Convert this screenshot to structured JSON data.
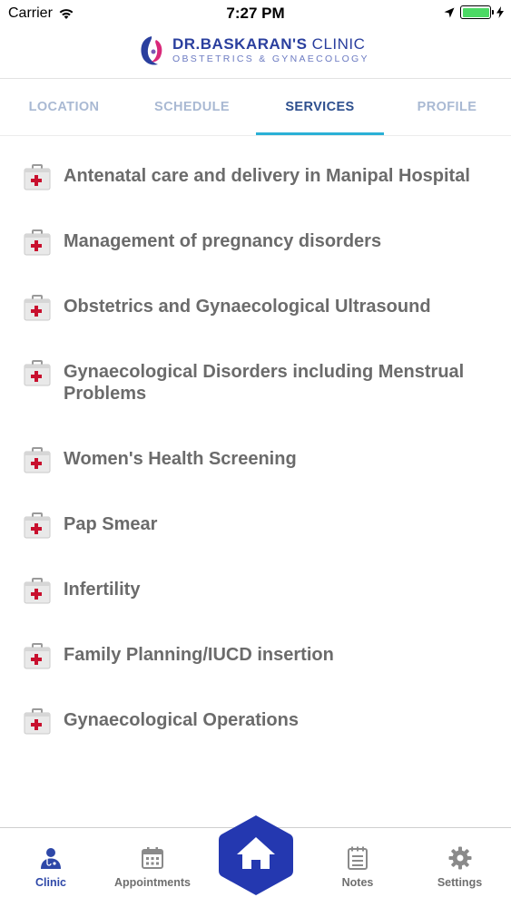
{
  "status_bar": {
    "carrier": "Carrier",
    "time": "7:27 PM"
  },
  "header": {
    "brand_strong": "DR.BASKARAN'S",
    "brand_light": " CLINIC",
    "subtitle": "OBSTETRICS & GYNAECOLOGY"
  },
  "tabs": [
    {
      "label": "LOCATION",
      "active": false
    },
    {
      "label": "SCHEDULE",
      "active": false
    },
    {
      "label": "SERVICES",
      "active": true
    },
    {
      "label": "PROFILE",
      "active": false
    }
  ],
  "services": [
    {
      "label": "Antenatal care and delivery in Manipal Hospital"
    },
    {
      "label": "Management of pregnancy disorders"
    },
    {
      "label": "Obstetrics and Gynaecological Ultrasound"
    },
    {
      "label": "Gynaecological Disorders including Menstrual Problems"
    },
    {
      "label": "Women's Health Screening"
    },
    {
      "label": "Pap Smear"
    },
    {
      "label": "Infertility"
    },
    {
      "label": "Family Planning/IUCD insertion"
    },
    {
      "label": "Gynaecological Operations"
    }
  ],
  "bottom_nav": {
    "clinic": {
      "label": "Clinic",
      "icon": "doctor-icon",
      "active": true
    },
    "appointments": {
      "label": "Appointments",
      "icon": "calendar-icon",
      "active": false
    },
    "home": {
      "icon": "home-icon"
    },
    "notes": {
      "label": "Notes",
      "icon": "notepad-icon",
      "active": false
    },
    "settings": {
      "label": "Settings",
      "icon": "gear-icon",
      "active": false
    }
  },
  "colors": {
    "brand": "#2a3f9e",
    "tab_indicator": "#2ab0d6",
    "home_button": "#2438b0",
    "kit_cross": "#c8102e",
    "battery": "#4cd964"
  }
}
